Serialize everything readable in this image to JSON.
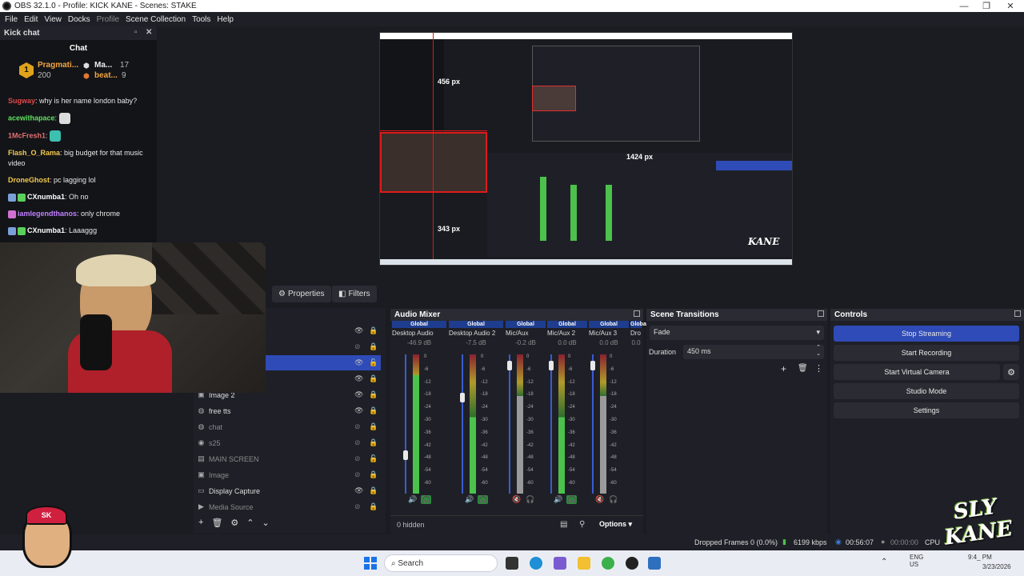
{
  "window": {
    "title": "OBS 32.1.0 - Profile: KICK KANE - Scenes: STAKE"
  },
  "menu": [
    "File",
    "Edit",
    "View",
    "Docks",
    "Profile",
    "Scene Collection",
    "Tools",
    "Help"
  ],
  "chat": {
    "dock_title": "Kick chat",
    "title": "Chat",
    "leader1_name": "Pragmati...",
    "leader1_score": "200",
    "leader1_rank": "1",
    "leader2_name": "Ma...",
    "leader2_score": "17",
    "leader3_name": "beat...",
    "leader3_score": "9",
    "messages": [
      {
        "user": "Sugway",
        "text": "why is her name london baby?",
        "color": "#e04848"
      },
      {
        "user": "acewithapace",
        "text": "",
        "color": "#60e060"
      },
      {
        "user": "1McFresh1",
        "text": "",
        "color": "#e07070"
      },
      {
        "user": "Flash_O_Rama",
        "text": "big budget for that music video",
        "color": "#f2c94c"
      },
      {
        "user": "DroneGhost",
        "text": "pc lagging lol",
        "color": "#f2c94c"
      },
      {
        "user": "CXnumba1",
        "text": "Oh no",
        "color": "#ffffff"
      },
      {
        "user": "iamlegendthanos",
        "text": "only chrome",
        "color": "#c080ff"
      },
      {
        "user": "CXnumba1",
        "text": "Laaaggg",
        "color": "#ffffff"
      }
    ]
  },
  "preview": {
    "width_label": "456 px",
    "height_label": "343 px",
    "nested_width_label": "1424 px"
  },
  "props_bar": {
    "properties": "Properties",
    "filters": "Filters"
  },
  "sources": {
    "items": [
      {
        "name": "",
        "visible": true,
        "locked": true,
        "selected": false
      },
      {
        "name": "",
        "visible": false,
        "locked": true,
        "selected": false
      },
      {
        "name": "",
        "visible": true,
        "locked": false,
        "selected": true
      },
      {
        "name": "",
        "visible": true,
        "locked": true,
        "selected": false
      },
      {
        "name": "Image 2",
        "visible": true,
        "locked": true,
        "selected": false
      },
      {
        "name": "free tts",
        "visible": true,
        "locked": true,
        "selected": false
      },
      {
        "name": "chat",
        "visible": false,
        "locked": true,
        "selected": false
      },
      {
        "name": "s25",
        "visible": false,
        "locked": true,
        "selected": false
      },
      {
        "name": "MAIN SCREEN",
        "visible": false,
        "locked": false,
        "selected": false
      },
      {
        "name": "Image",
        "visible": false,
        "locked": true,
        "selected": false
      },
      {
        "name": "Display Capture",
        "visible": true,
        "locked": true,
        "selected": false
      },
      {
        "name": "Media Source",
        "visible": false,
        "locked": true,
        "selected": false
      }
    ]
  },
  "mixer": {
    "title": "Audio Mixer",
    "hidden_label": "0 hidden",
    "options": "Options",
    "channels": [
      {
        "global": "Global",
        "name": "Desktop Audio",
        "db": "-46.9 dB",
        "level": 0.25,
        "muted": false
      },
      {
        "global": "Global",
        "name": "Desktop Audio 2",
        "db": "-7.5 dB",
        "level": 0.7,
        "muted": false
      },
      {
        "global": "Global",
        "name": "Mic/Aux",
        "db": "-0.2 dB",
        "level": 0.95,
        "muted": true
      },
      {
        "global": "Global",
        "name": "Mic/Aux 2",
        "db": "0.0 dB",
        "level": 0.95,
        "muted": false
      },
      {
        "global": "Global",
        "name": "Mic/Aux 3",
        "db": "0.0 dB",
        "level": 0.95,
        "muted": true
      },
      {
        "global": "Global",
        "name": "Dro",
        "db": "0.0",
        "level": 0.95,
        "muted": false
      }
    ],
    "ticks": [
      "0",
      "-6",
      "-12",
      "-18",
      "-24",
      "-30",
      "-36",
      "-42",
      "-48",
      "-54",
      "-60"
    ]
  },
  "transitions": {
    "title": "Scene Transitions",
    "selected": "Fade",
    "duration_label": "Duration",
    "duration_value": "450 ms"
  },
  "controls": {
    "title": "Controls",
    "buttons": [
      "Stop Streaming",
      "Start Recording",
      "Start Virtual Camera",
      "Studio Mode",
      "Settings"
    ]
  },
  "status": {
    "dropped": "Dropped Frames 0 (0.0%)",
    "kbps": "6199 kbps",
    "live_time": "00:56:07",
    "rec_time": "00:00:00",
    "cpu": "CPU"
  },
  "taskbar": {
    "search_placeholder": "Search",
    "lang": "ENG US",
    "time": "9:4_ PM",
    "date": "3/23/2026"
  },
  "overlay": {
    "logo_text": "SLY KANE",
    "avatar_text": "SK"
  },
  "colors": {
    "accent": "#2f4bb7",
    "meter_green": "#4cc24c",
    "meter_dark_green": "#2e6e2e",
    "meter_yellow": "#b09a2a",
    "meter_red": "#8a2030"
  }
}
